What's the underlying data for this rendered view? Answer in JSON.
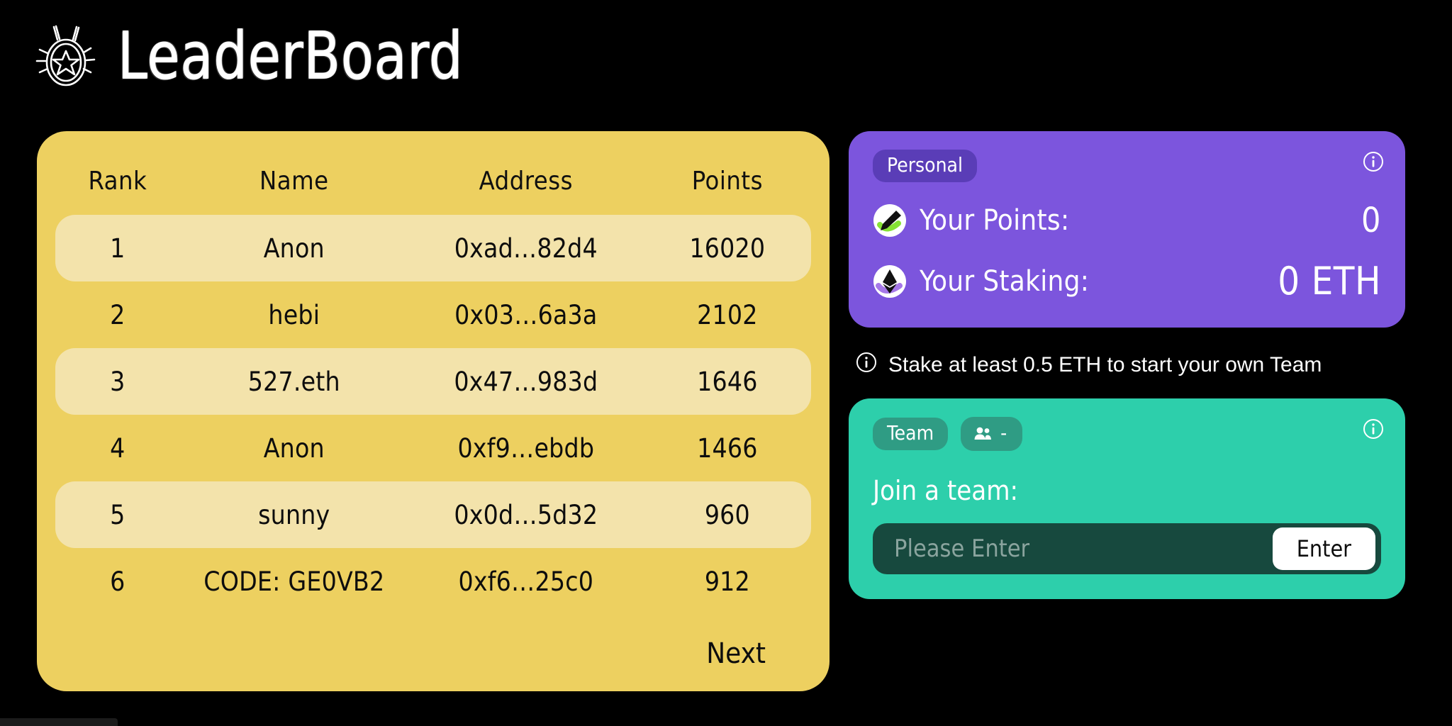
{
  "header": {
    "title": "LeaderBoard",
    "medal_icon": "medal-star-icon"
  },
  "leaderboard": {
    "columns": [
      "Rank",
      "Name",
      "Address",
      "Points"
    ],
    "rows": [
      {
        "rank": "1",
        "name": "Anon",
        "address": "0xad…82d4",
        "points": "16020"
      },
      {
        "rank": "2",
        "name": "hebi",
        "address": "0x03…6a3a",
        "points": "2102"
      },
      {
        "rank": "3",
        "name": "527.eth",
        "address": "0x47…983d",
        "points": "1646"
      },
      {
        "rank": "4",
        "name": "Anon",
        "address": "0xf9…ebdb",
        "points": "1466"
      },
      {
        "rank": "5",
        "name": "sunny",
        "address": "0x0d…5d32",
        "points": "960"
      },
      {
        "rank": "6",
        "name": "CODE: GE0VB2",
        "address": "0xf6…25c0",
        "points": "912"
      }
    ],
    "next_label": "Next",
    "card_color": "#edd060",
    "row_alt_color": "#f3e3ab"
  },
  "personal": {
    "badge": "Personal",
    "info_icon": "info-circle-icon",
    "points_icon": "pencil-highlight-icon",
    "points_label": "Your Points:",
    "points_value": "0",
    "staking_icon": "ethereum-icon",
    "staking_label": "Your Staking:",
    "staking_value": "0 ETH",
    "card_color": "#7c55dd",
    "badge_color": "#5a3db7"
  },
  "hint": {
    "icon": "info-circle-icon",
    "text": "Stake at least 0.5 ETH to start your own Team"
  },
  "team": {
    "badge": "Team",
    "members_icon": "people-icon",
    "members_count": "-",
    "info_icon": "info-circle-icon",
    "join_label": "Join a team:",
    "input_value": "",
    "input_placeholder": "Please Enter",
    "enter_label": "Enter",
    "card_color": "#2dcfab",
    "badge_color": "#2f9c84",
    "input_color": "#17493e"
  }
}
